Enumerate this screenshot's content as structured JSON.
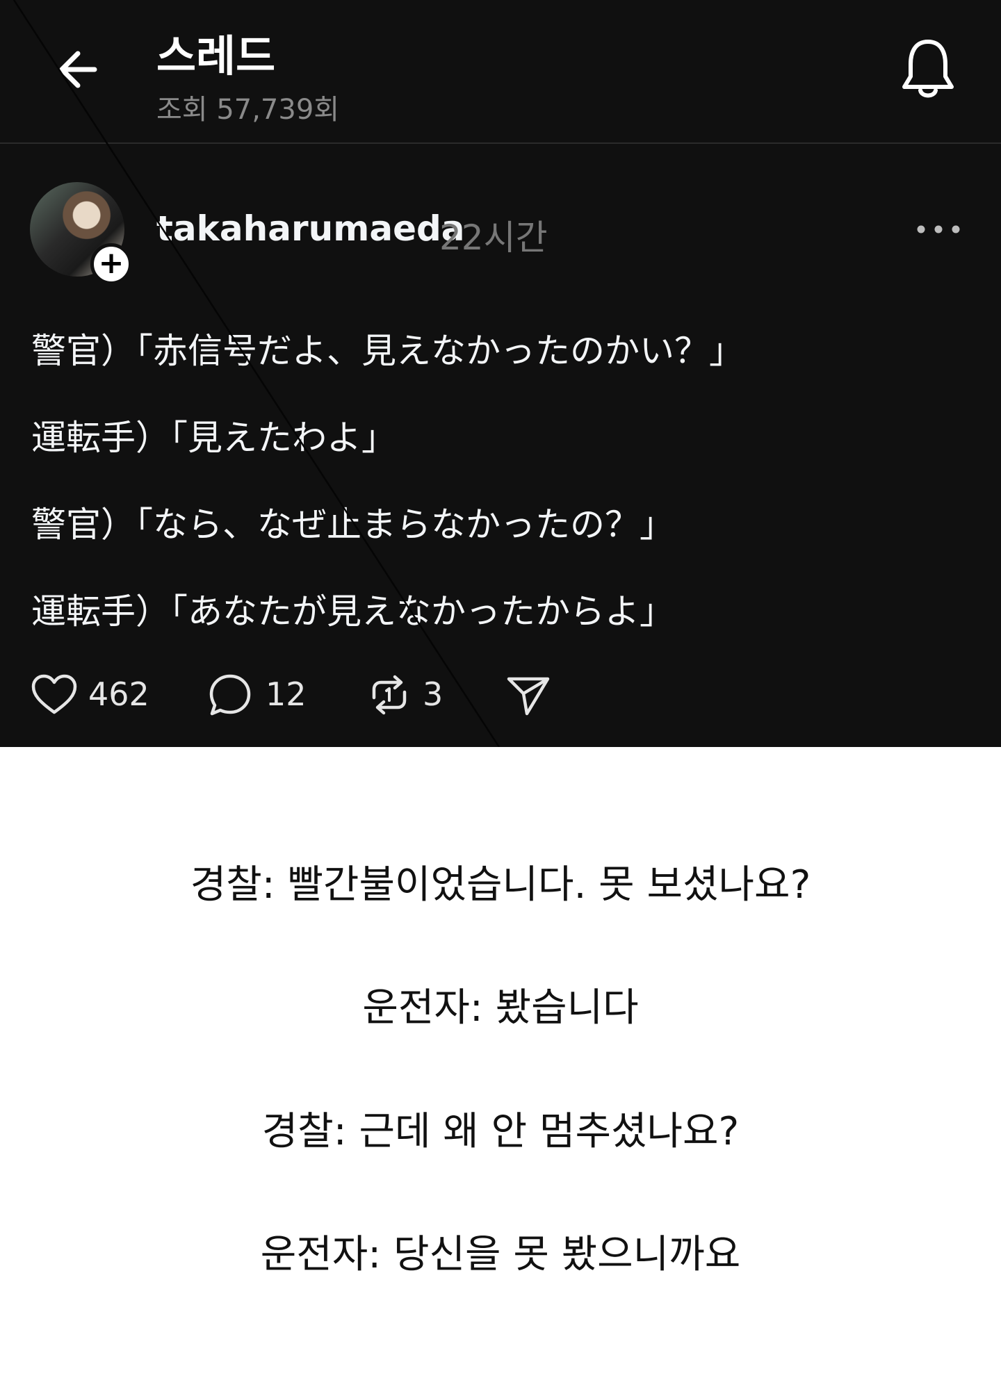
{
  "header": {
    "title": "스레드",
    "views": "조회 57,739회"
  },
  "post": {
    "username": "takaharumaeda",
    "time": "22시간",
    "lines": [
      "警官）「赤信号だよ、見えなかったのかい？」",
      "運転手）「見えたわよ」",
      "警官）「なら、なぜ止まらなかったの？」",
      "運転手）「あなたが見えなかったからよ」"
    ],
    "actions": {
      "likes": "462",
      "replies": "12",
      "reposts": "3"
    }
  },
  "translation": {
    "lines": [
      "경찰: 빨간불이었습니다. 못 보셨나요?",
      "운전자: 봤습니다",
      "경찰: 근데 왜 안 멈추셨나요?",
      "운전자: 당신을 못 봤으니까요"
    ]
  },
  "icons": {
    "back": "arrow-left-icon",
    "bell": "bell-icon",
    "more": "more-horizontal-icon",
    "like": "heart-icon",
    "reply": "comment-icon",
    "repost": "repost-icon",
    "share": "send-icon"
  },
  "colors": {
    "background_dark": "#101010",
    "text_light": "#f3f5f7",
    "muted": "#8a8a8a",
    "background_light": "#ffffff"
  }
}
